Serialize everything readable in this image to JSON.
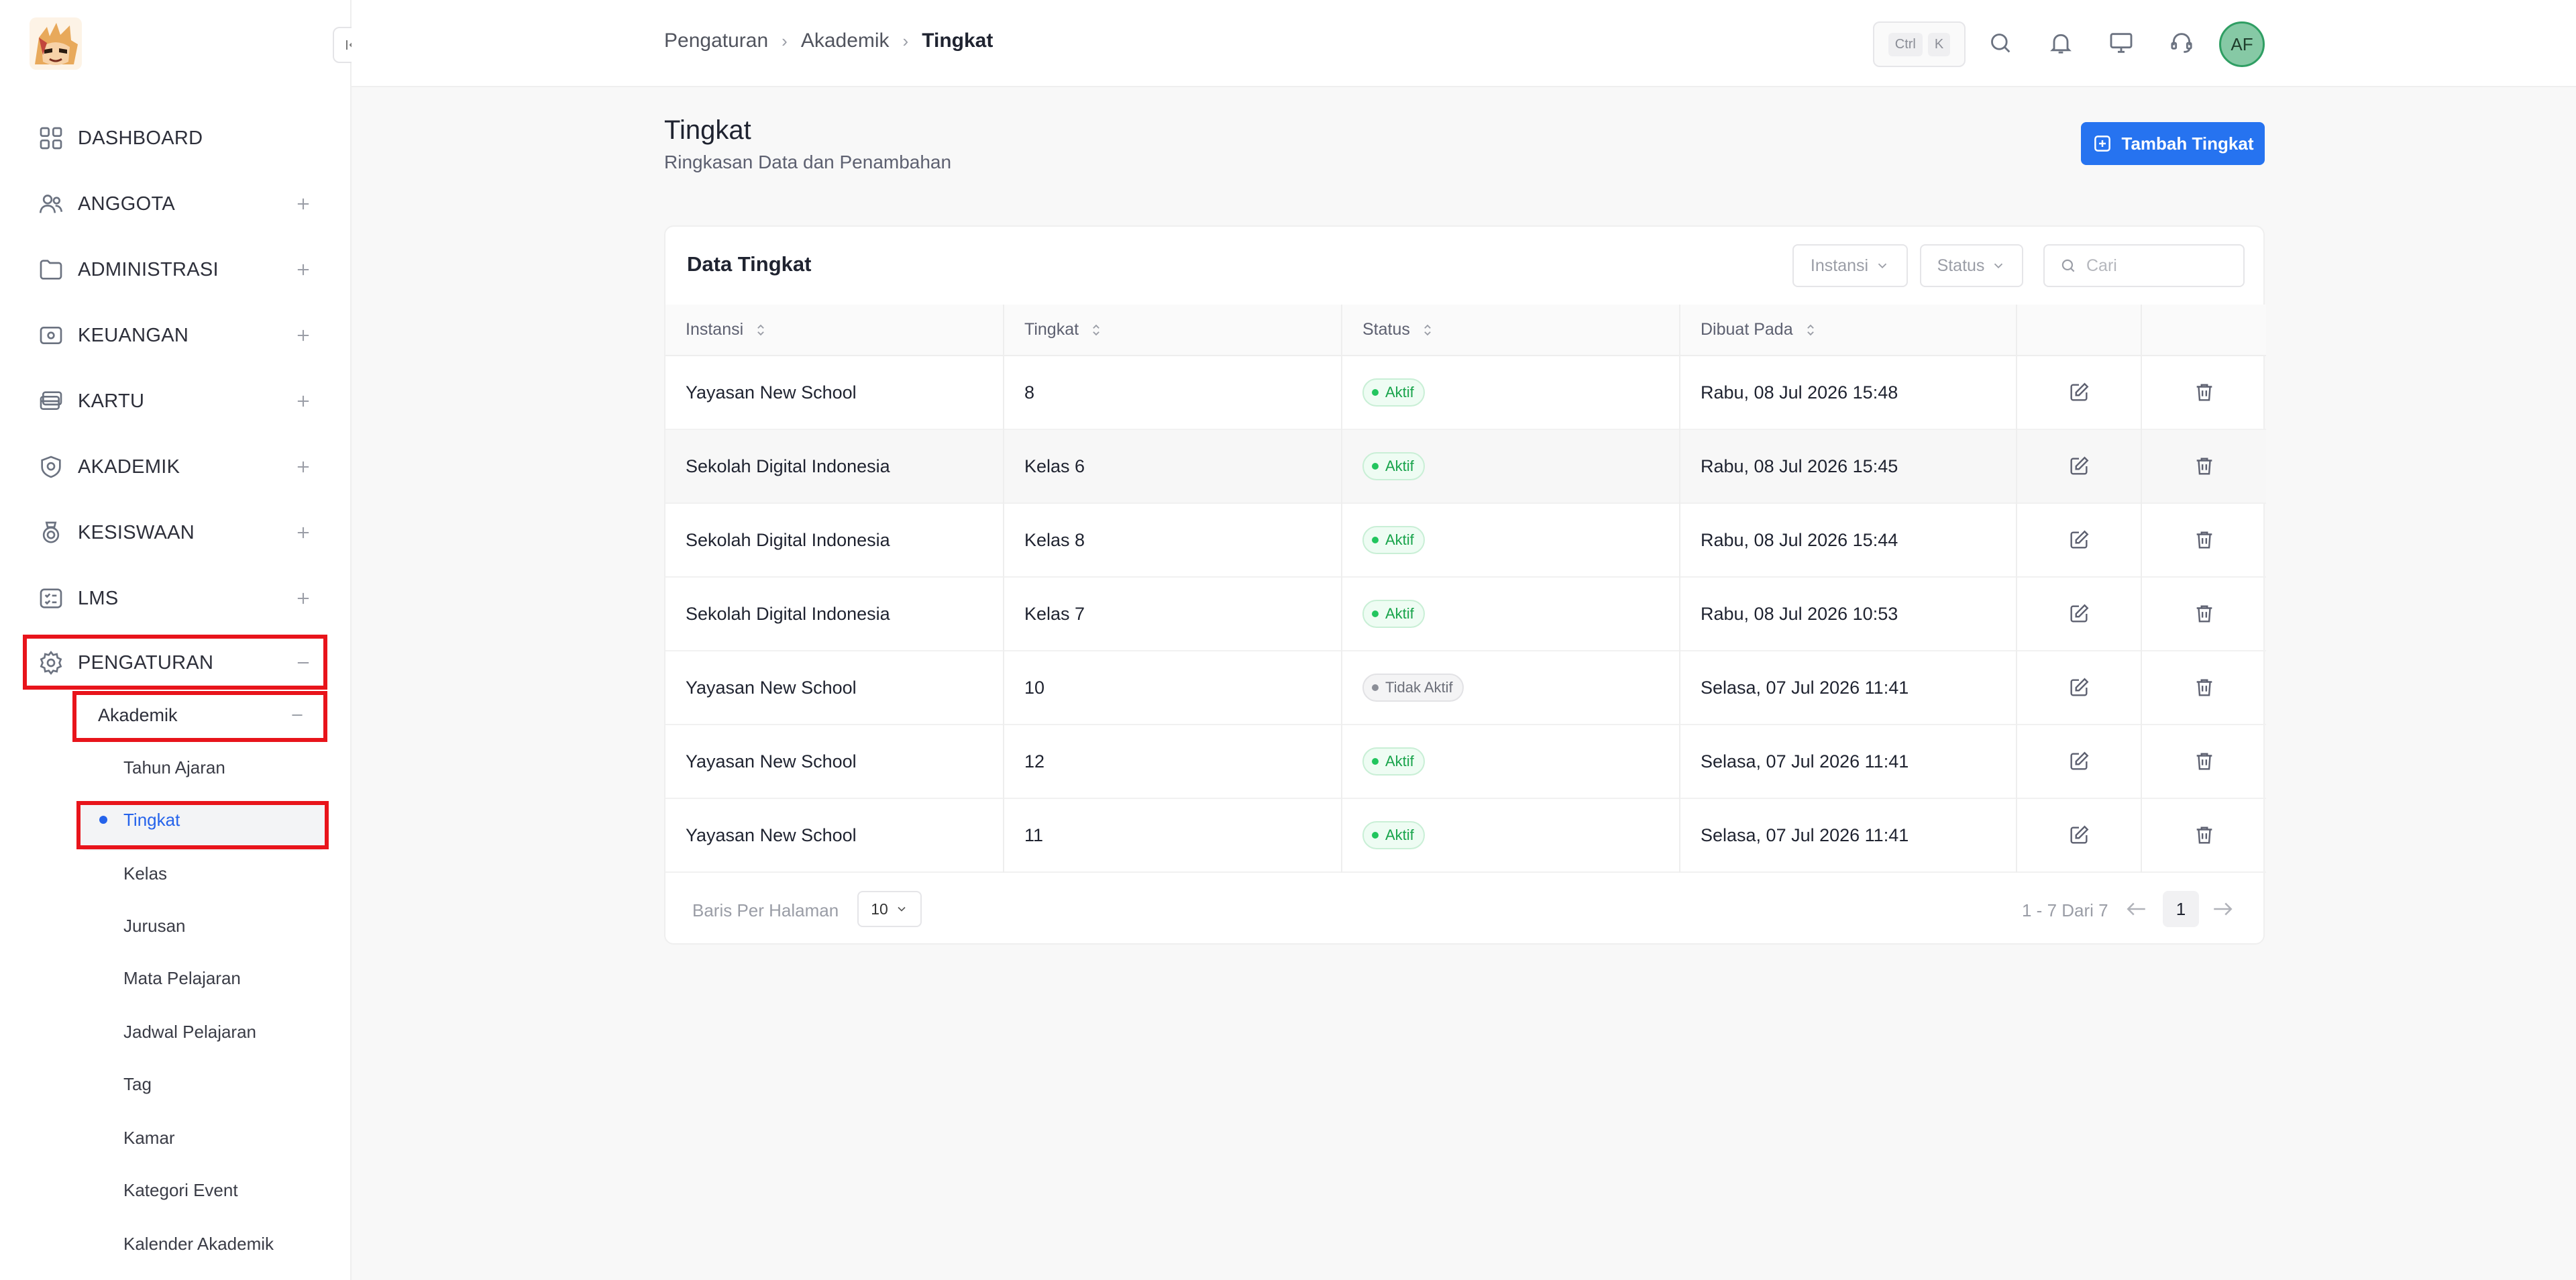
{
  "sidebar": {
    "items": [
      {
        "name": "dashboard",
        "label": "DASHBOARD",
        "icon": "grid-icon"
      },
      {
        "name": "anggota",
        "label": "ANGGOTA",
        "icon": "users-icon"
      },
      {
        "name": "administrasi",
        "label": "ADMINISTRASI",
        "icon": "folder-icon"
      },
      {
        "name": "keuangan",
        "label": "KEUANGAN",
        "icon": "money-icon"
      },
      {
        "name": "kartu",
        "label": "KARTU",
        "icon": "card-icon"
      },
      {
        "name": "akademik",
        "label": "AKADEMIK",
        "icon": "shield-icon"
      },
      {
        "name": "kesiswaan",
        "label": "KESISWAAN",
        "icon": "medal-icon"
      },
      {
        "name": "lms",
        "label": "LMS",
        "icon": "list-icon"
      },
      {
        "name": "pengaturan",
        "label": "PENGATURAN",
        "icon": "gear-icon"
      }
    ],
    "submenu_label": "Akademik",
    "sublinks": [
      "Tahun Ajaran",
      "Tingkat",
      "Kelas",
      "Jurusan",
      "Mata Pelajaran",
      "Jadwal Pelajaran",
      "Tag",
      "Kamar",
      "Kategori Event",
      "Kalender Akademik"
    ],
    "active_sublink": "Tingkat"
  },
  "breadcrumb": [
    "Pengaturan",
    "Akademik",
    "Tingkat"
  ],
  "shortcut": {
    "key1": "Ctrl",
    "key2": "K"
  },
  "user": {
    "initials": "AF"
  },
  "page": {
    "title": "Tingkat",
    "subtitle": "Ringkasan Data dan Penambahan",
    "add_button": "Tambah Tingkat"
  },
  "card": {
    "title": "Data Tingkat",
    "filter_instansi": "Instansi",
    "filter_status": "Status",
    "search_placeholder": "Cari"
  },
  "table": {
    "headers": [
      "Instansi",
      "Tingkat",
      "Status",
      "Dibuat Pada"
    ],
    "rows": [
      {
        "instansi": "Yayasan New School",
        "tingkat": "8",
        "status": "Aktif",
        "active": true,
        "dibuat": "Rabu, 08 Jul 2026 15:48"
      },
      {
        "instansi": "Sekolah Digital Indonesia",
        "tingkat": "Kelas 6",
        "status": "Aktif",
        "active": true,
        "dibuat": "Rabu, 08 Jul 2026 15:45"
      },
      {
        "instansi": "Sekolah Digital Indonesia",
        "tingkat": "Kelas 8",
        "status": "Aktif",
        "active": true,
        "dibuat": "Rabu, 08 Jul 2026 15:44"
      },
      {
        "instansi": "Sekolah Digital Indonesia",
        "tingkat": "Kelas 7",
        "status": "Aktif",
        "active": true,
        "dibuat": "Rabu, 08 Jul 2026 10:53"
      },
      {
        "instansi": "Yayasan New School",
        "tingkat": "10",
        "status": "Tidak Aktif",
        "active": false,
        "dibuat": "Selasa, 07 Jul 2026 11:41"
      },
      {
        "instansi": "Yayasan New School",
        "tingkat": "12",
        "status": "Aktif",
        "active": true,
        "dibuat": "Selasa, 07 Jul 2026 11:41"
      },
      {
        "instansi": "Yayasan New School",
        "tingkat": "11",
        "status": "Aktif",
        "active": true,
        "dibuat": "Selasa, 07 Jul 2026 11:41"
      }
    ]
  },
  "pagination": {
    "rows_label": "Baris Per Halaman",
    "rows_per_page": "10",
    "range": "1 - 7 Dari 7",
    "current_page": "1"
  },
  "colors": {
    "accent": "#2673f0",
    "highlight": "#e8141b",
    "active_green": "#22c55e"
  }
}
